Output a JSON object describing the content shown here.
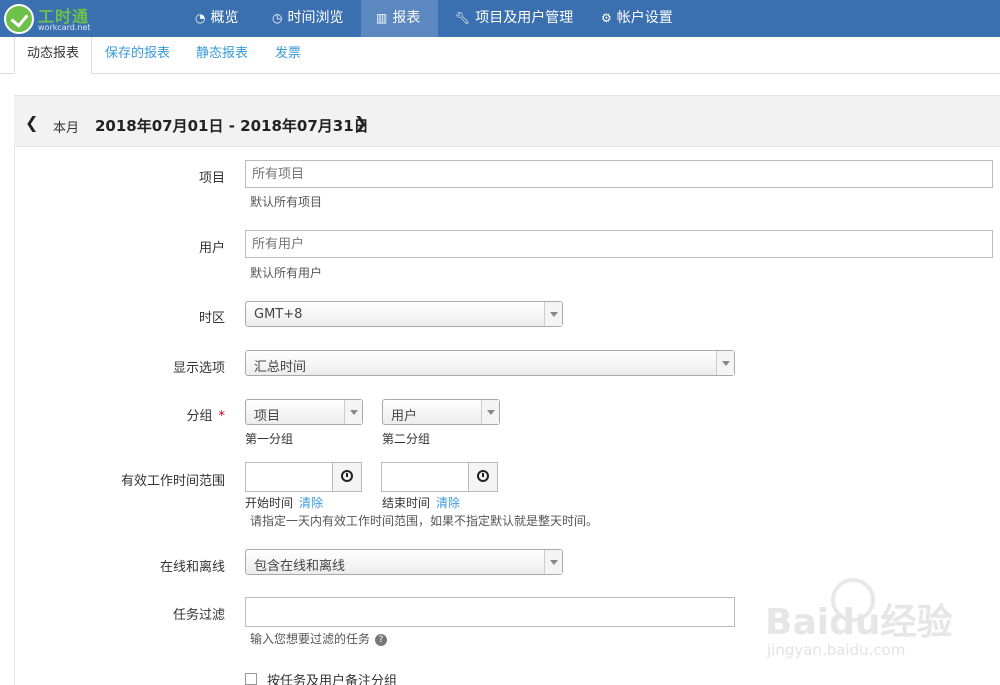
{
  "logo": {
    "brand": "工时通",
    "sub": "workcard.net"
  },
  "nav": {
    "overview": "概览",
    "time_browse": "时间浏览",
    "report": "报表",
    "projects_users": "项目及用户管理",
    "account": "帐户设置"
  },
  "tabs": [
    "动态报表",
    "保存的报表",
    "静态报表",
    "发票"
  ],
  "datebar": {
    "period": "本月",
    "range": "2018年07月01日 - 2018年07月31日"
  },
  "form": {
    "project": {
      "label": "项目",
      "placeholder": "所有项目",
      "help": "默认所有项目"
    },
    "user": {
      "label": "用户",
      "placeholder": "所有用户",
      "help": "默认所有用户"
    },
    "timezone": {
      "label": "时区",
      "value": "GMT+8"
    },
    "display": {
      "label": "显示选项",
      "value": "汇总时间"
    },
    "group": {
      "label": "分组",
      "required_mark": "*",
      "first_value": "项目",
      "first_caption": "第一分组",
      "second_value": "用户",
      "second_caption": "第二分组"
    },
    "work_range": {
      "label": "有效工作时间范围",
      "start_label": "开始时间",
      "end_label": "结束时间",
      "clear": "清除",
      "help": "请指定一天内有效工作时间范围，如果不指定默认就是整天时间。"
    },
    "online": {
      "label": "在线和离线",
      "value": "包含在线和离线"
    },
    "task_filter": {
      "label": "任务过滤",
      "help": "输入您想要过滤的任务",
      "help_icon": "?"
    },
    "group_by_note": {
      "label": "按任务及用户备注分组"
    }
  },
  "watermark": {
    "text": "Baidu经验",
    "url": "jingyan.baidu.com"
  },
  "colors": {
    "nav_bg": "#3a6fb0",
    "nav_active": "#5b88bf",
    "link": "#3a9ad9",
    "required": "#d0021b",
    "logo_green": "#6ec04a"
  }
}
